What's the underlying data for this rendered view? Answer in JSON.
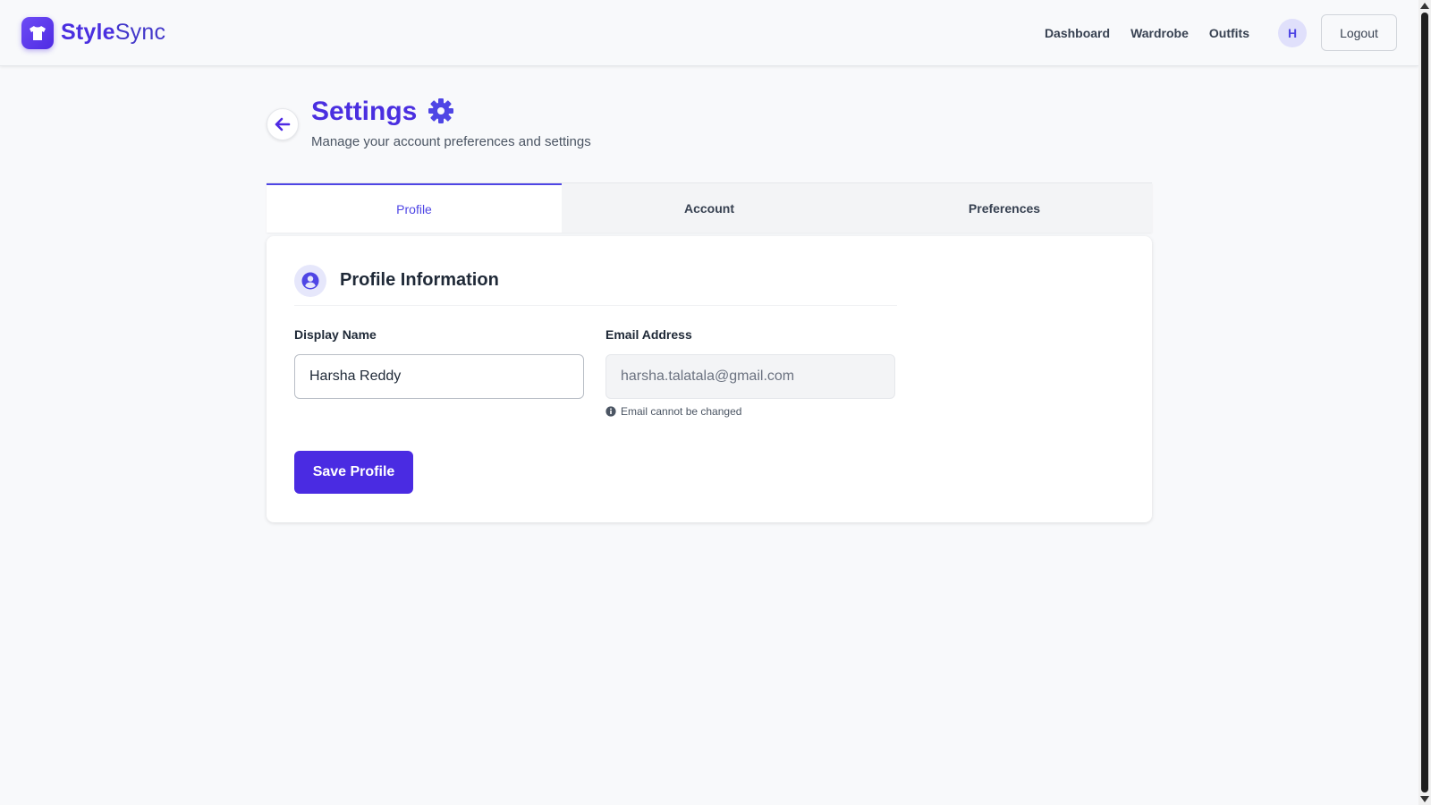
{
  "brand": {
    "name_part1": "Style",
    "name_part2": "Sync",
    "logo_icon": "tshirt-icon"
  },
  "nav": {
    "links": [
      "Dashboard",
      "Wardrobe",
      "Outfits"
    ],
    "avatar_initial": "H",
    "logout_label": "Logout"
  },
  "page": {
    "title": "Settings",
    "title_icon": "gear-icon",
    "subtitle": "Manage your account preferences and settings",
    "back_icon": "arrow-left-icon"
  },
  "tabs": [
    {
      "label": "Profile",
      "active": true
    },
    {
      "label": "Account",
      "active": false
    },
    {
      "label": "Preferences",
      "active": false
    }
  ],
  "profile": {
    "section_title": "Profile Information",
    "section_icon": "user-circle-icon",
    "display_name_label": "Display Name",
    "display_name_value": "Harsha Reddy",
    "email_label": "Email Address",
    "email_value": "harsha.talatala@gmail.com",
    "email_hint": "Email cannot be changed",
    "hint_icon": "info-circle-icon",
    "save_label": "Save Profile"
  },
  "colors": {
    "primary": "#4a2fe0",
    "accent": "#4f46e5",
    "background": "#f8f9fb"
  }
}
